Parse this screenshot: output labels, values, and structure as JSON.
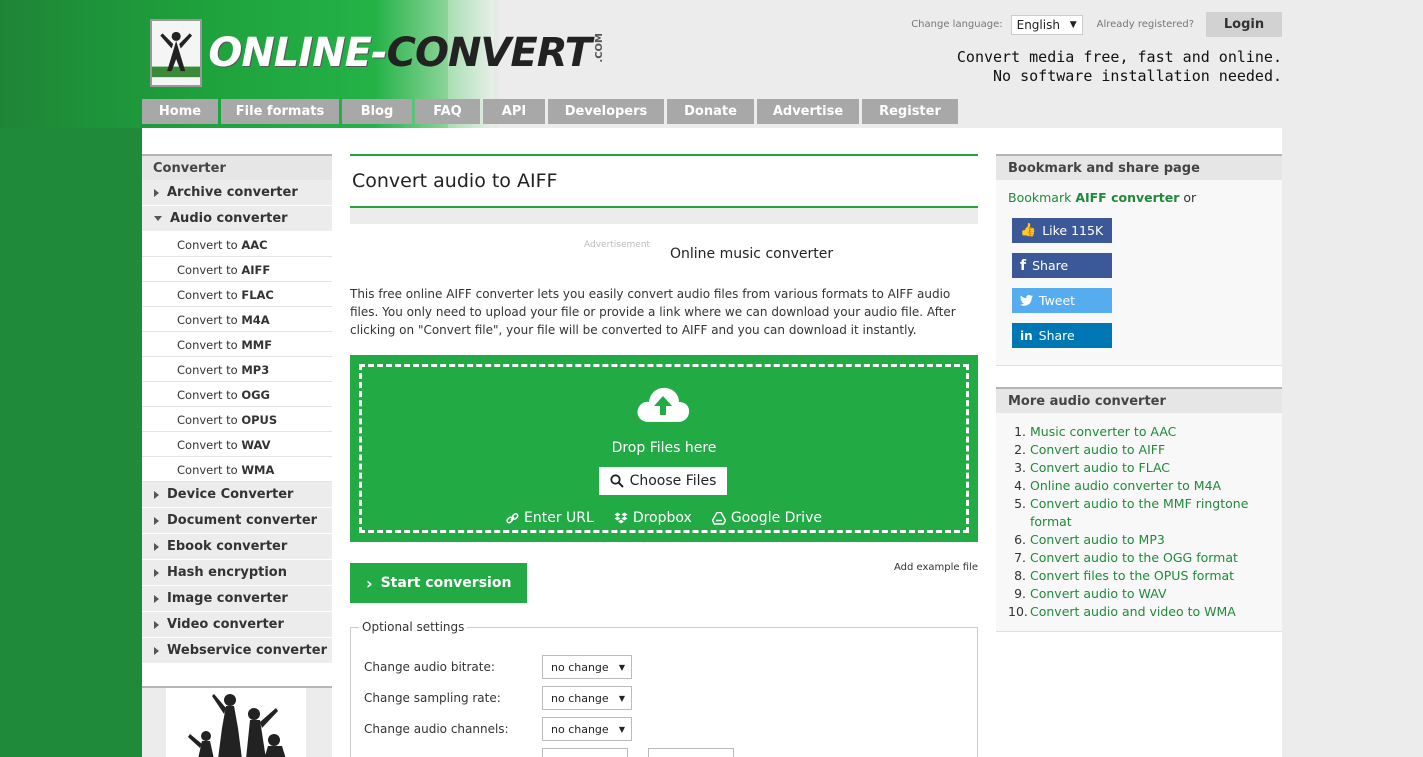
{
  "header": {
    "logo_text_white": "ONLINE-",
    "logo_text_dark": "CONVERT",
    "logo_suffix": ".COM",
    "change_language_label": "Change language:",
    "language_value": "English",
    "already_registered": "Already registered?",
    "login_label": "Login",
    "tagline_1": "Convert media free, fast and online.",
    "tagline_2": "No software installation needed."
  },
  "nav": [
    {
      "label": "Home"
    },
    {
      "label": "File formats"
    },
    {
      "label": "Blog"
    },
    {
      "label": "FAQ"
    },
    {
      "label": "API"
    },
    {
      "label": "Developers"
    },
    {
      "label": "Donate"
    },
    {
      "label": "Advertise"
    },
    {
      "label": "Register"
    }
  ],
  "sidebar": {
    "heading": "Converter",
    "cat_archive": "Archive converter",
    "cat_audio": "Audio converter",
    "convert_to": "Convert to",
    "audio_items": [
      "AAC",
      "AIFF",
      "FLAC",
      "M4A",
      "MMF",
      "MP3",
      "OGG",
      "OPUS",
      "WAV",
      "WMA"
    ],
    "cat_device": "Device Converter",
    "cat_document": "Document converter",
    "cat_ebook": "Ebook converter",
    "cat_hash": "Hash encryption",
    "cat_image": "Image converter",
    "cat_video": "Video converter",
    "cat_webservice": "Webservice converter"
  },
  "main": {
    "title": "Convert audio to AIFF",
    "ad_label": "Advertisement",
    "subtitle": "Online music converter",
    "description": "This free online AIFF converter lets you easily convert audio files from various formats to AIFF audio files. You only need to upload your file or provide a link where we can download your audio file. After clicking on \"Convert file\", your file will be converted to AIFF and you can download it instantly.",
    "drop_text": "Drop Files here",
    "choose_files": "Choose Files",
    "enter_url": "Enter URL",
    "dropbox": "Dropbox",
    "google_drive": "Google Drive",
    "start_conversion": "Start conversion",
    "add_example": "Add example file",
    "optional_settings": "Optional settings",
    "opt_bitrate": "Change audio bitrate:",
    "opt_sampling": "Change sampling rate:",
    "opt_channels": "Change audio channels:",
    "no_change": "no change"
  },
  "right": {
    "bookmark_heading": "Bookmark and share page",
    "bookmark_prefix": "Bookmark ",
    "bookmark_bold": "AIFF converter",
    "bookmark_suffix": " or",
    "like_label": "Like 115K",
    "fb_share": "Share",
    "tweet": "Tweet",
    "in_share": "Share",
    "more_heading": "More audio converter",
    "more_items": [
      "Music converter to AAC",
      "Convert audio to AIFF",
      "Convert audio to FLAC",
      "Online audio converter to M4A",
      "Convert audio to the MMF ringtone format",
      "Convert audio to MP3",
      "Convert audio to the OGG format",
      "Convert files to the OPUS format",
      "Convert audio to WAV",
      "Convert audio and video to WMA"
    ]
  },
  "colors": {
    "brand_green": "#22aa44",
    "link_green": "#1f8a3a",
    "facebook": "#3b5998",
    "twitter": "#55acee",
    "linkedin": "#0077b5"
  }
}
